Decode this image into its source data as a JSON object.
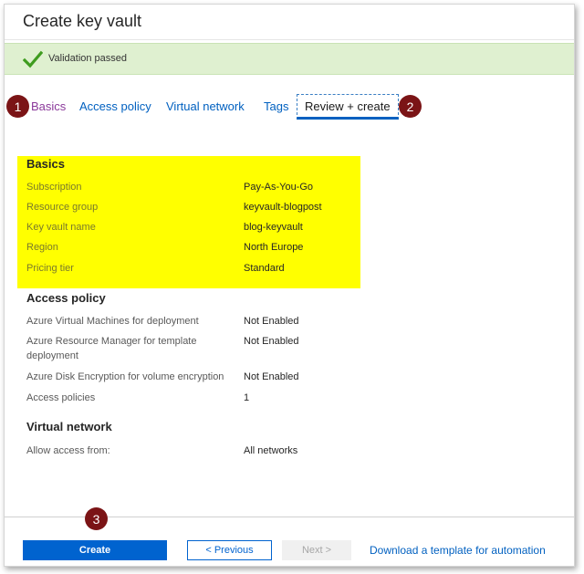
{
  "window": {
    "title": "Create key vault"
  },
  "validation": {
    "text": "Validation passed",
    "color": "#dff0d0"
  },
  "tabs": [
    {
      "label": "Basics"
    },
    {
      "label": "Access policy"
    },
    {
      "label": "Virtual network"
    },
    {
      "label": "Tags"
    },
    {
      "label": "Review + create"
    }
  ],
  "badges": {
    "one": "1",
    "two": "2",
    "three": "3"
  },
  "basics": {
    "title": "Basics",
    "rows": [
      {
        "label": "Subscription",
        "value": "Pay-As-You-Go"
      },
      {
        "label": "Resource group",
        "value": "keyvault-blogpost"
      },
      {
        "label": "Key vault name",
        "value": "blog-keyvault"
      },
      {
        "label": "Region",
        "value": "North Europe"
      },
      {
        "label": "Pricing tier",
        "value": "Standard"
      }
    ]
  },
  "access_policy": {
    "title": "Access policy",
    "rows": [
      {
        "label": "Azure Virtual Machines for deployment",
        "value": "Not Enabled"
      },
      {
        "label": "Azure Resource Manager for template deployment",
        "value": "Not Enabled"
      },
      {
        "label": "Azure Disk Encryption for volume encryption",
        "value": "Not Enabled"
      },
      {
        "label": "Access policies",
        "value": "1"
      }
    ]
  },
  "virtual_network": {
    "title": "Virtual network",
    "rows": [
      {
        "label": "Allow access from:",
        "value": "All networks"
      }
    ]
  },
  "footer": {
    "create_label": "Create",
    "previous_label": "< Previous",
    "next_label": "Next >",
    "download_label": "Download a template for automation"
  },
  "colors": {
    "accent": "#0063cf",
    "highlight": "#ffff00",
    "badge": "#7b1416"
  },
  "icons": {
    "validation": "checkmark-icon"
  }
}
